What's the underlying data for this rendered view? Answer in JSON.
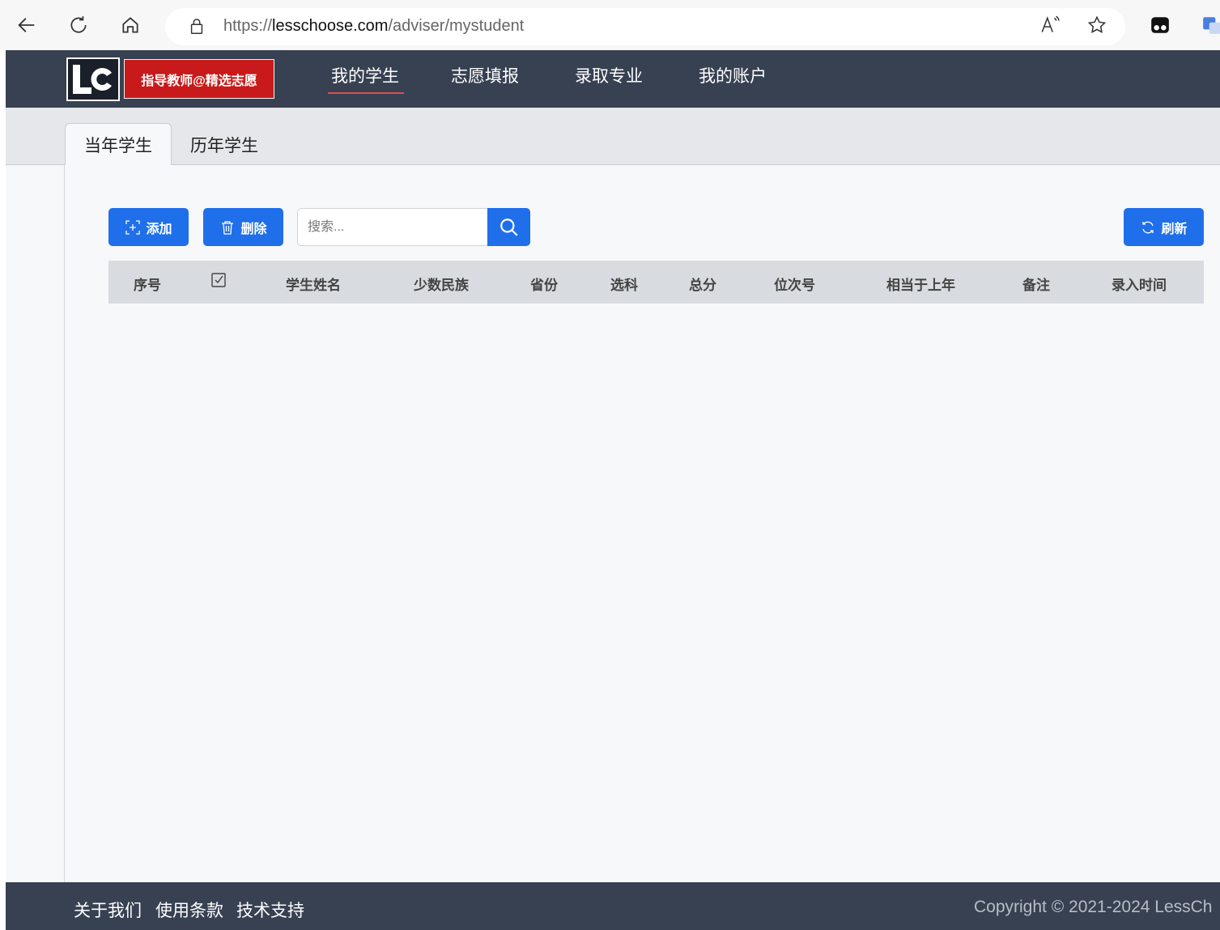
{
  "browser": {
    "url_prefix": "https://",
    "url_host": "lesschoose.com",
    "url_path": "/adviser/mystudent"
  },
  "header": {
    "logo_text": "LC",
    "role_badge": "指导教师@精选志愿",
    "nav": [
      {
        "label": "我的学生",
        "active": true
      },
      {
        "label": "志愿填报"
      },
      {
        "label": "录取专业"
      },
      {
        "label": "我的账户"
      }
    ]
  },
  "tabs": [
    {
      "label": "当年学生",
      "active": true
    },
    {
      "label": "历年学生"
    }
  ],
  "toolbar": {
    "add_label": "添加",
    "delete_label": "删除",
    "search_placeholder": "搜索...",
    "refresh_label": "刷新"
  },
  "table": {
    "columns": [
      "序号",
      "学生姓名",
      "少数民族",
      "省份",
      "选科",
      "总分",
      "位次号",
      "相当于上年",
      "备注",
      "录入时间"
    ]
  },
  "footer": {
    "links": [
      "关于我们",
      "使用条款",
      "技术支持"
    ],
    "copyright": "Copyright © 2021-2024 LessCh"
  },
  "colors": {
    "nav_bg": "#374152",
    "primary": "#1f6feb",
    "badge_red": "#c81a1a"
  }
}
